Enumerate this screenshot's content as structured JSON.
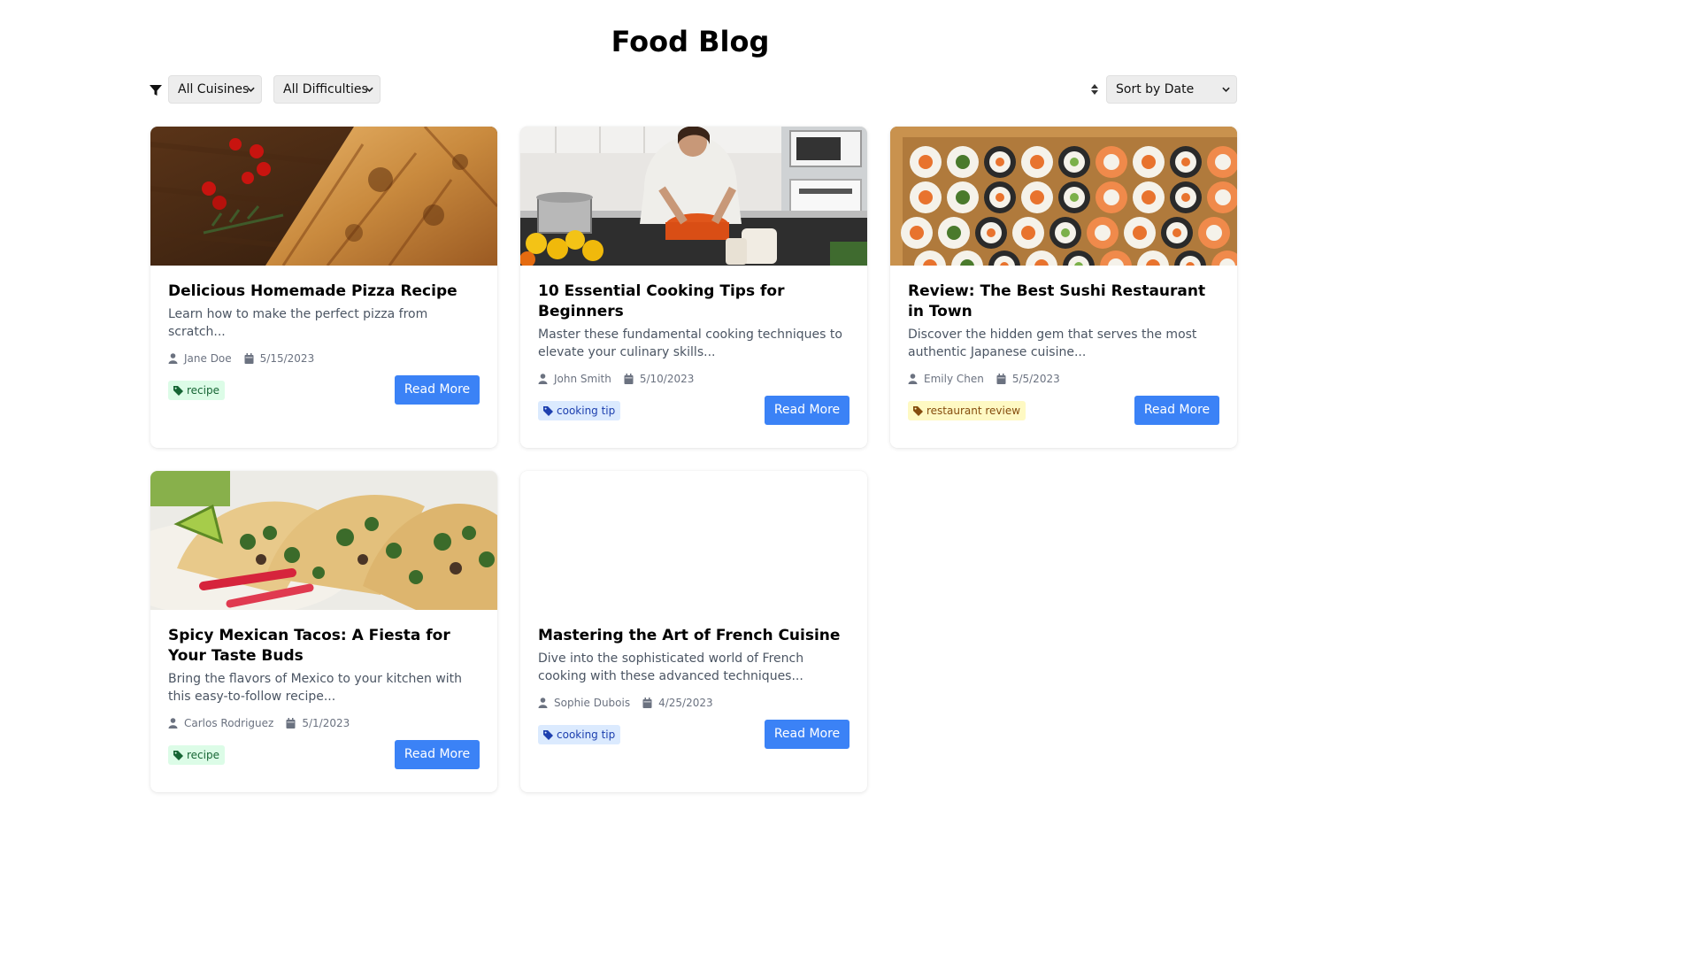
{
  "header": {
    "title": "Food Blog"
  },
  "filters": {
    "cuisine_value": "All Cuisines",
    "difficulty_value": "All Difficulties",
    "sort_value": "Sort by Date"
  },
  "posts": [
    {
      "title": "Delicious Homemade Pizza Recipe",
      "description": "Learn how to make the perfect pizza from scratch...",
      "author": "Jane Doe",
      "date": "5/15/2023",
      "tag": "recipe",
      "button": "Read More",
      "image": "pizza"
    },
    {
      "title": "10 Essential Cooking Tips for Beginners",
      "description": "Master these fundamental cooking techniques to elevate your culinary skills...",
      "author": "John Smith",
      "date": "5/10/2023",
      "tag": "cooking tip",
      "button": "Read More",
      "image": "cooking-kitchen"
    },
    {
      "title": "Review: The Best Sushi Restaurant in Town",
      "description": "Discover the hidden gem that serves the most authentic Japanese cuisine...",
      "author": "Emily Chen",
      "date": "5/5/2023",
      "tag": "restaurant review",
      "button": "Read More",
      "image": "sushi"
    },
    {
      "title": "Spicy Mexican Tacos: A Fiesta for Your Taste Buds",
      "description": "Bring the flavors of Mexico to your kitchen with this easy-to-follow recipe...",
      "author": "Carlos Rodriguez",
      "date": "5/1/2023",
      "tag": "recipe",
      "button": "Read More",
      "image": "tacos"
    },
    {
      "title": "Mastering the Art of French Cuisine",
      "description": "Dive into the sophisticated world of French cooking with these advanced techniques...",
      "author": "Sophie Dubois",
      "date": "4/25/2023",
      "tag": "cooking tip",
      "button": "Read More",
      "image": "blank"
    }
  ],
  "colors": {
    "button_blue": "#3b82f6",
    "tag_recipe_bg": "#dcfce7",
    "tag_tip_bg": "#dbeafe",
    "tag_review_bg": "#fef9c3"
  },
  "icons": [
    "filter-icon",
    "sort-icon",
    "chevron-down-icon",
    "user-icon",
    "calendar-icon",
    "tag-icon"
  ]
}
